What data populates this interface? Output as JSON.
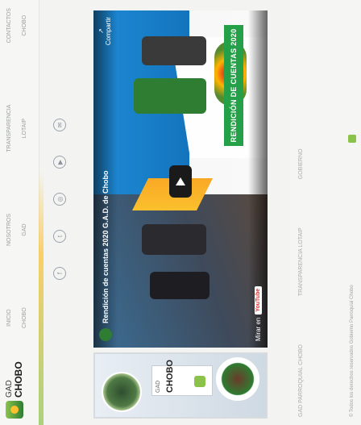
{
  "header": {
    "brand_prefix": "GAD",
    "brand_name": "CHOBO",
    "nav": [
      {
        "label": "INICIO",
        "sub": "CHOBO"
      },
      {
        "label": "NOSOTROS",
        "sub": "GAD"
      },
      {
        "label": "TRANSPARENCIA",
        "sub": "LOTAIP"
      },
      {
        "label": "CONTACTOS",
        "sub": "CHOBO"
      }
    ]
  },
  "social": {
    "icons": [
      "facebook-icon",
      "twitter-icon",
      "instagram-icon",
      "youtube-icon",
      "mail-icon"
    ]
  },
  "video": {
    "title": "Rendición de cuentas 2020 G.A.D. de Chobo",
    "share_label": "Compartir",
    "banner_text": "RENDICIÓN DE CUENTAS 2020",
    "watch_on": "Mirar en",
    "platform": "YouTube"
  },
  "card": {
    "sign_prefix": "GAD",
    "sign_name": "CHOBO"
  },
  "footer": {
    "links": [
      "GAD PARROQUIAL CHOBO",
      "TRANSPARENCIA LOTAIP",
      "GOBIERNO"
    ],
    "copyright": "© Todos los derechos reservados Gobierno Parroquial Chobo"
  }
}
